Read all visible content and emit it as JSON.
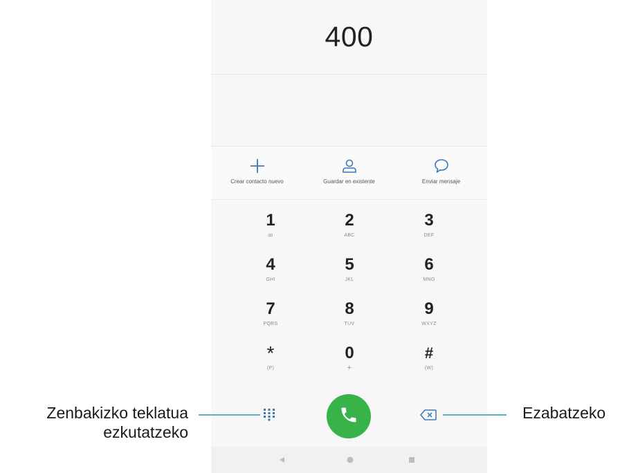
{
  "dialer": {
    "number": "400",
    "actions": [
      {
        "label": "Crear contacto nuevo",
        "icon": "plus-icon"
      },
      {
        "label": "Guardar en existente",
        "icon": "person-icon"
      },
      {
        "label": "Enviar mensaje",
        "icon": "chat-bubble-icon"
      }
    ],
    "keys": [
      {
        "digit": "1",
        "sub": "ꝏ"
      },
      {
        "digit": "2",
        "sub": "ABC"
      },
      {
        "digit": "3",
        "sub": "DEF"
      },
      {
        "digit": "4",
        "sub": "GHI"
      },
      {
        "digit": "5",
        "sub": "JKL"
      },
      {
        "digit": "6",
        "sub": "MNO"
      },
      {
        "digit": "7",
        "sub": "PQRS"
      },
      {
        "digit": "8",
        "sub": "TUV"
      },
      {
        "digit": "9",
        "sub": "WXYZ"
      },
      {
        "digit": "*",
        "sub": "(P)"
      },
      {
        "digit": "0",
        "sub": "+"
      },
      {
        "digit": "#",
        "sub": "(W)"
      }
    ],
    "bottom": {
      "left_icon": "dialpad-grid-icon",
      "center_icon": "phone-call-icon",
      "right_icon": "backspace-icon"
    },
    "nav": {
      "back_icon": "back-triangle-icon",
      "home_icon": "home-circle-icon",
      "recent_icon": "recent-square-icon"
    },
    "colors": {
      "accent_blue": "#3a78b4",
      "call_green": "#37b34a",
      "leader_teal": "#57b7b7"
    }
  },
  "annotations": {
    "left_line1": "Zenbakizko teklatua",
    "left_line2": "ezkutatzeko",
    "right": "Ezabatzeko"
  }
}
